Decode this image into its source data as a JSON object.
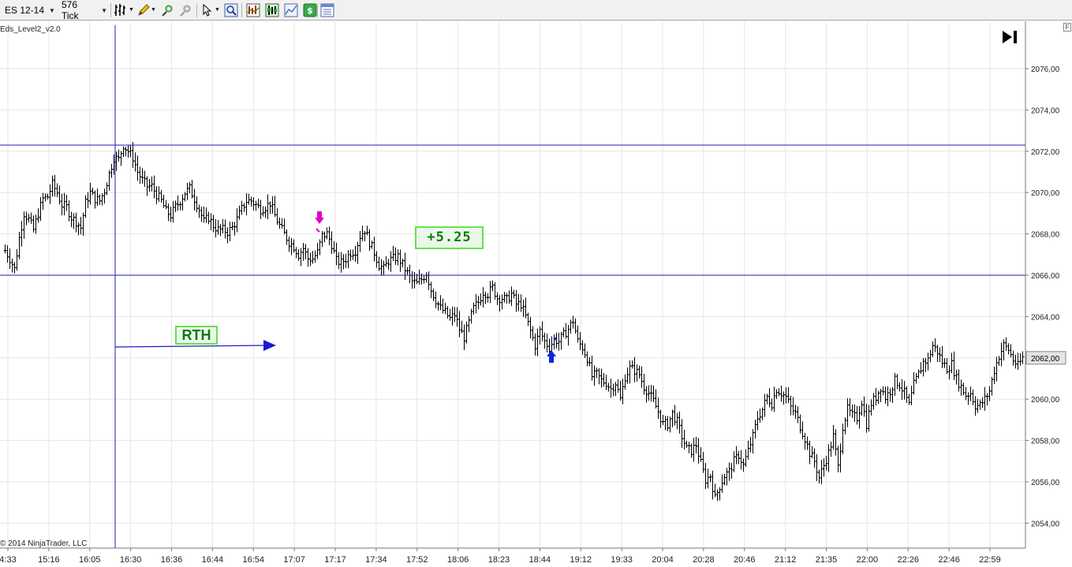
{
  "toolbar": {
    "instrument": "ES 12-14",
    "interval": "576 Tick",
    "buttons": [
      {
        "name": "bar-type-icon"
      },
      {
        "name": "drawing-pencil-icon"
      },
      {
        "name": "zoom-in-icon"
      },
      {
        "name": "zoom-out-icon"
      },
      {
        "name": "cursor-icon"
      },
      {
        "name": "magnifier-icon"
      },
      {
        "name": "indicators-icon"
      },
      {
        "name": "strategies-icon"
      },
      {
        "name": "chart-properties-icon"
      },
      {
        "name": "money-icon"
      },
      {
        "name": "data-box-icon"
      }
    ]
  },
  "chart": {
    "indicator_name": "Eds_Level2_v2.0",
    "copyright": "© 2014 NinjaTrader, LLC",
    "f_button": "F",
    "current_price_label": "2062,00",
    "rth_label": "RTH",
    "pnl_label": "+5.25",
    "colors": {
      "bar": "#000000",
      "level_line": "#1c1cb4",
      "arrow": "#1c1cd0",
      "sell_marker": "#e000c8",
      "buy_marker": "#0a2ad8",
      "label_border": "#66e24d",
      "label_text": "#0b7a12",
      "grid": "#e6e6e6"
    }
  },
  "chart_data": {
    "type": "line",
    "title": "",
    "instrument": "ES 12-14",
    "interval": "576 Tick",
    "xlabel": "",
    "ylabel": "",
    "y_ticks": [
      "2054,00",
      "2056,00",
      "2058,00",
      "2060,00",
      "2062,00",
      "2064,00",
      "2066,00",
      "2068,00",
      "2070,00",
      "2072,00",
      "2074,00",
      "2076,00"
    ],
    "y_values": [
      2054,
      2056,
      2058,
      2060,
      2062,
      2064,
      2066,
      2068,
      2070,
      2072,
      2074,
      2076
    ],
    "ylim": [
      2053.3,
      2078.2
    ],
    "x_ticks": [
      "4:33",
      "15:16",
      "16:05",
      "16:30",
      "16:36",
      "16:44",
      "16:54",
      "17:07",
      "17:17",
      "17:34",
      "17:52",
      "18:06",
      "18:23",
      "18:44",
      "19:12",
      "19:33",
      "20:04",
      "20:28",
      "20:46",
      "21:12",
      "21:35",
      "22:00",
      "22:26",
      "22:46",
      "22:59"
    ],
    "horizontal_levels": [
      2072.3,
      2066.0
    ],
    "current_price": 2062.0,
    "close_path": [
      [
        0,
        2067.2
      ],
      [
        6,
        2066.8
      ],
      [
        12,
        2066.3
      ],
      [
        18,
        2067.8
      ],
      [
        24,
        2069.0
      ],
      [
        30,
        2068.7
      ],
      [
        36,
        2068.2
      ],
      [
        42,
        2069.0
      ],
      [
        48,
        2069.7
      ],
      [
        54,
        2069.8
      ],
      [
        60,
        2070.4
      ],
      [
        66,
        2070.0
      ],
      [
        72,
        2069.4
      ],
      [
        78,
        2069.3
      ],
      [
        84,
        2068.8
      ],
      [
        90,
        2068.6
      ],
      [
        96,
        2068.3
      ],
      [
        102,
        2069.5
      ],
      [
        108,
        2070.0
      ],
      [
        114,
        2069.7
      ],
      [
        120,
        2069.6
      ],
      [
        126,
        2070.1
      ],
      [
        132,
        2070.9
      ],
      [
        138,
        2071.7
      ],
      [
        144,
        2071.6
      ],
      [
        150,
        2072.3
      ],
      [
        156,
        2072.0
      ],
      [
        162,
        2071.7
      ],
      [
        168,
        2071.0
      ],
      [
        174,
        2070.6
      ],
      [
        180,
        2070.3
      ],
      [
        186,
        2070.3
      ],
      [
        192,
        2069.9
      ],
      [
        198,
        2069.6
      ],
      [
        204,
        2069.1
      ],
      [
        210,
        2068.9
      ],
      [
        216,
        2069.3
      ],
      [
        222,
        2069.6
      ],
      [
        228,
        2070.0
      ],
      [
        234,
        2070.2
      ],
      [
        240,
        2069.7
      ],
      [
        246,
        2069.2
      ],
      [
        252,
        2068.6
      ],
      [
        258,
        2068.8
      ],
      [
        264,
        2068.4
      ],
      [
        270,
        2068.2
      ],
      [
        276,
        2068.2
      ],
      [
        282,
        2068.1
      ],
      [
        288,
        2068.3
      ],
      [
        294,
        2068.7
      ],
      [
        300,
        2069.2
      ],
      [
        306,
        2069.6
      ],
      [
        312,
        2069.6
      ],
      [
        318,
        2069.4
      ],
      [
        324,
        2069.2
      ],
      [
        330,
        2069.3
      ],
      [
        336,
        2069.5
      ],
      [
        342,
        2068.9
      ],
      [
        348,
        2068.4
      ],
      [
        354,
        2068.0
      ],
      [
        360,
        2067.6
      ],
      [
        366,
        2067.4
      ],
      [
        372,
        2067.0
      ],
      [
        378,
        2067.3
      ],
      [
        384,
        2066.8
      ],
      [
        390,
        2066.8
      ],
      [
        396,
        2067.1
      ],
      [
        402,
        2067.9
      ],
      [
        408,
        2068.0
      ],
      [
        414,
        2067.5
      ],
      [
        420,
        2066.7
      ],
      [
        426,
        2066.6
      ],
      [
        432,
        2066.8
      ],
      [
        438,
        2067.1
      ],
      [
        444,
        2067.2
      ],
      [
        450,
        2067.9
      ],
      [
        456,
        2068.2
      ],
      [
        462,
        2067.6
      ],
      [
        468,
        2067.1
      ],
      [
        474,
        2066.5
      ],
      [
        480,
        2066.3
      ],
      [
        486,
        2066.7
      ],
      [
        492,
        2066.8
      ],
      [
        498,
        2066.9
      ],
      [
        504,
        2066.5
      ],
      [
        510,
        2066.1
      ],
      [
        516,
        2065.7
      ],
      [
        522,
        2065.6
      ],
      [
        528,
        2065.8
      ],
      [
        534,
        2066.1
      ],
      [
        540,
        2065.3
      ],
      [
        546,
        2064.8
      ],
      [
        552,
        2064.4
      ],
      [
        558,
        2064.2
      ],
      [
        564,
        2063.9
      ],
      [
        570,
        2064.1
      ],
      [
        576,
        2063.4
      ],
      [
        582,
        2063.0
      ],
      [
        588,
        2063.7
      ],
      [
        594,
        2064.4
      ],
      [
        600,
        2064.7
      ],
      [
        606,
        2065.2
      ],
      [
        612,
        2065.1
      ],
      [
        618,
        2065.4
      ],
      [
        624,
        2064.9
      ],
      [
        630,
        2064.9
      ],
      [
        636,
        2064.8
      ],
      [
        642,
        2065.1
      ],
      [
        648,
        2064.6
      ],
      [
        654,
        2064.6
      ],
      [
        660,
        2064.0
      ],
      [
        666,
        2063.3
      ],
      [
        672,
        2062.6
      ],
      [
        678,
        2063.3
      ],
      [
        684,
        2062.8
      ],
      [
        690,
        2062.5
      ],
      [
        696,
        2062.9
      ],
      [
        702,
        2062.8
      ],
      [
        708,
        2063.1
      ],
      [
        714,
        2063.4
      ],
      [
        720,
        2063.8
      ],
      [
        726,
        2062.8
      ],
      [
        732,
        2062.5
      ],
      [
        738,
        2062.0
      ],
      [
        744,
        2061.1
      ],
      [
        750,
        2061.2
      ],
      [
        756,
        2060.9
      ],
      [
        762,
        2060.8
      ],
      [
        768,
        2060.5
      ],
      [
        774,
        2060.8
      ],
      [
        780,
        2060.0
      ],
      [
        786,
        2061.1
      ],
      [
        792,
        2061.5
      ],
      [
        798,
        2061.4
      ],
      [
        804,
        2061.2
      ],
      [
        810,
        2060.6
      ],
      [
        816,
        2060.3
      ],
      [
        822,
        2059.9
      ],
      [
        828,
        2059.4
      ],
      [
        834,
        2058.8
      ],
      [
        840,
        2058.8
      ],
      [
        846,
        2059.3
      ],
      [
        852,
        2058.9
      ],
      [
        858,
        2058.2
      ],
      [
        864,
        2057.6
      ],
      [
        870,
        2057.5
      ],
      [
        876,
        2057.8
      ],
      [
        882,
        2056.9
      ],
      [
        888,
        2056.1
      ],
      [
        894,
        2056.3
      ],
      [
        900,
        2055.2
      ],
      [
        906,
        2055.8
      ],
      [
        912,
        2056.3
      ],
      [
        918,
        2056.5
      ],
      [
        924,
        2057.0
      ],
      [
        930,
        2057.3
      ],
      [
        936,
        2056.8
      ],
      [
        942,
        2057.5
      ],
      [
        948,
        2058.2
      ],
      [
        954,
        2059.1
      ],
      [
        960,
        2059.5
      ],
      [
        966,
        2060.1
      ],
      [
        972,
        2059.8
      ],
      [
        978,
        2060.5
      ],
      [
        984,
        2060.3
      ],
      [
        990,
        2060.1
      ],
      [
        996,
        2059.6
      ],
      [
        1002,
        2059.3
      ],
      [
        1008,
        2058.7
      ],
      [
        1014,
        2058.1
      ],
      [
        1020,
        2057.4
      ],
      [
        1026,
        2057.0
      ],
      [
        1032,
        2056.2
      ],
      [
        1038,
        2056.8
      ],
      [
        1044,
        2057.4
      ],
      [
        1050,
        2058.2
      ],
      [
        1056,
        2056.7
      ],
      [
        1062,
        2058.7
      ],
      [
        1068,
        2059.5
      ],
      [
        1074,
        2059.2
      ],
      [
        1080,
        2059.1
      ],
      [
        1086,
        2059.9
      ],
      [
        1092,
        2058.8
      ],
      [
        1098,
        2059.8
      ],
      [
        1104,
        2060.1
      ],
      [
        1110,
        2060.6
      ],
      [
        1116,
        2060.1
      ],
      [
        1122,
        2060.4
      ],
      [
        1128,
        2060.9
      ],
      [
        1134,
        2060.7
      ],
      [
        1140,
        2060.3
      ],
      [
        1146,
        2059.7
      ],
      [
        1152,
        2060.7
      ],
      [
        1158,
        2061.2
      ],
      [
        1164,
        2061.8
      ],
      [
        1170,
        2061.9
      ],
      [
        1176,
        2062.6
      ],
      [
        1182,
        2062.3
      ],
      [
        1188,
        2061.8
      ],
      [
        1194,
        2061.5
      ],
      [
        1200,
        2061.7
      ],
      [
        1206,
        2061.0
      ],
      [
        1212,
        2060.6
      ],
      [
        1218,
        2060.2
      ],
      [
        1224,
        2060.3
      ],
      [
        1230,
        2059.7
      ],
      [
        1236,
        2059.7
      ],
      [
        1242,
        2060.0
      ],
      [
        1248,
        2060.4
      ],
      [
        1254,
        2061.4
      ],
      [
        1260,
        2062.1
      ],
      [
        1266,
        2062.6
      ],
      [
        1272,
        2062.4
      ],
      [
        1278,
        2061.9
      ],
      [
        1284,
        2061.6
      ],
      [
        1290,
        2062.0
      ]
    ]
  }
}
